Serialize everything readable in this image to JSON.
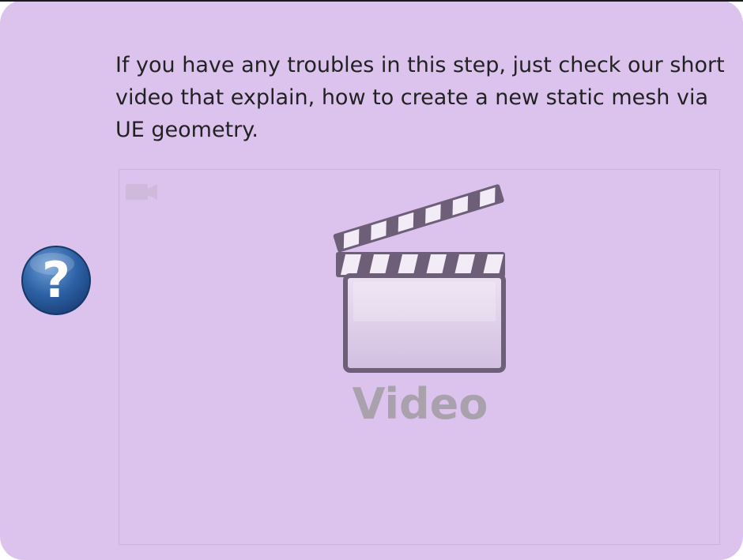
{
  "note": {
    "text": "If you have any troubles in this step, just check our short video that explain, how to create a new static mesh via UE geometry.",
    "icon": "question-mark-icon",
    "background_color": "#dcc3ee"
  },
  "video": {
    "label": "Video",
    "placeholder_icon": "clapperboard-icon",
    "corner_icon": "video-camera-icon"
  }
}
